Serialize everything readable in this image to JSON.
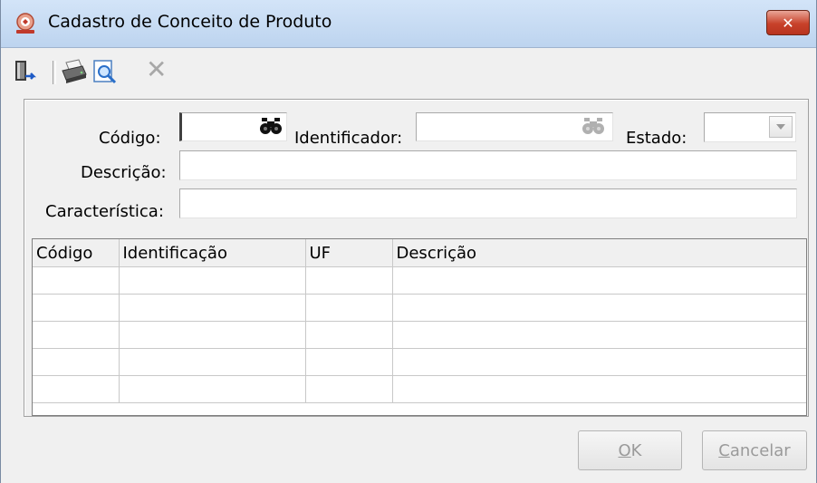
{
  "window": {
    "title": "Cadastro de Conceito de Produto",
    "close_glyph": "✕"
  },
  "toolbar": {
    "icons": [
      "exit-icon",
      "printer-icon",
      "preview-icon",
      "delete-icon"
    ],
    "delete_glyph": "✕"
  },
  "form": {
    "codigo_label": "Código:",
    "codigo_value": "",
    "identificador_label": "Identificador:",
    "identificador_value": "",
    "estado_label": "Estado:",
    "estado_value": "",
    "descricao_label": "Descrição:",
    "descricao_value": "",
    "caracteristica_label": "Característica:",
    "caracteristica_value": ""
  },
  "grid": {
    "columns": [
      "Código",
      "Identificação",
      "UF",
      "Descrição"
    ],
    "rows": [
      [
        "",
        "",
        "",
        ""
      ],
      [
        "",
        "",
        "",
        ""
      ],
      [
        "",
        "",
        "",
        ""
      ],
      [
        "",
        "",
        "",
        ""
      ],
      [
        "",
        "",
        "",
        ""
      ]
    ]
  },
  "buttons": {
    "ok_mnemonic": "O",
    "ok_rest": "K",
    "cancel_mnemonic": "C",
    "cancel_rest": "ancelar"
  },
  "colors": {
    "window_bg": "#f0f0f0",
    "titlebar": "#bdd4ef",
    "close_button": "#c8412a",
    "disabled_text": "#9a9a9a"
  }
}
